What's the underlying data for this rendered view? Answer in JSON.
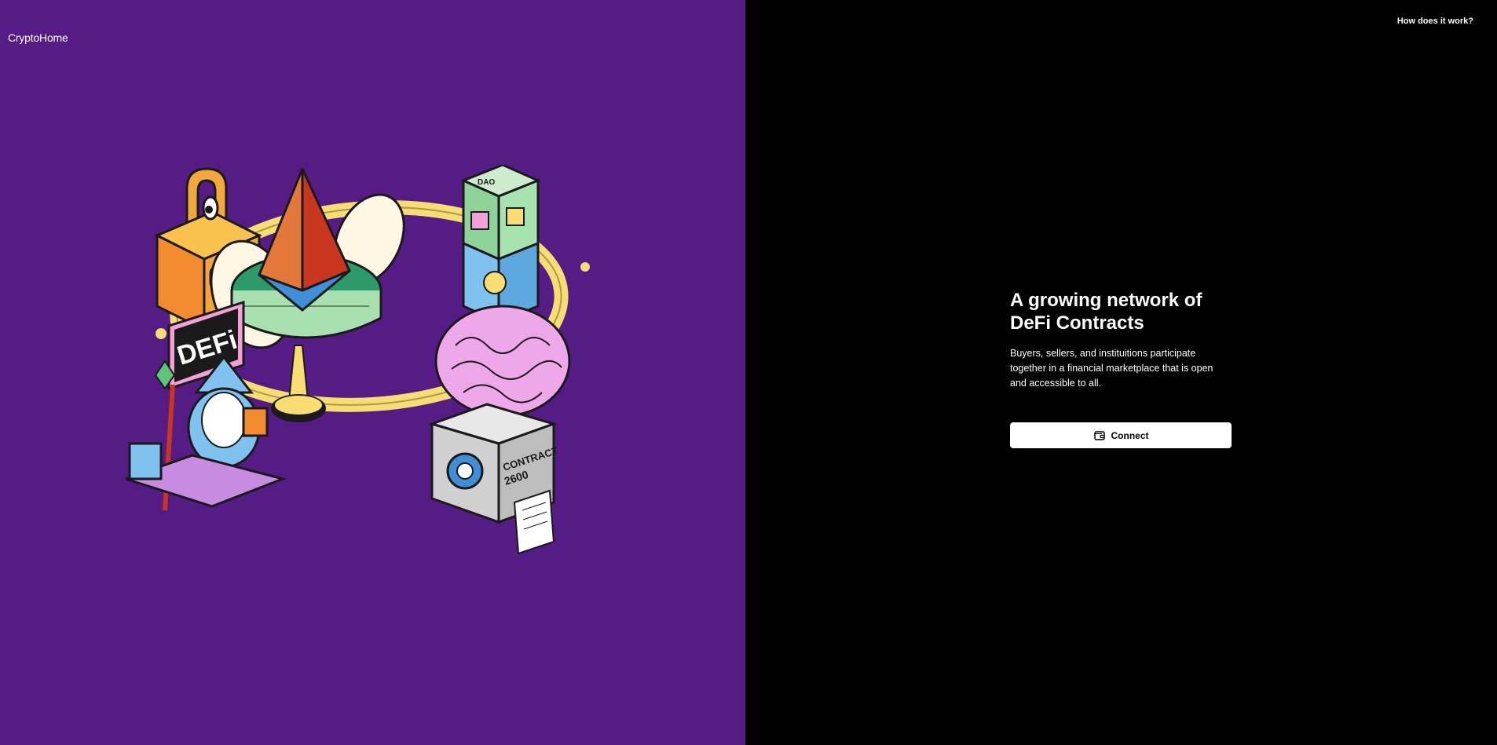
{
  "brand": {
    "name": "CryptoHome"
  },
  "header": {
    "help_link": "How does it work?"
  },
  "illustration": {
    "defi_sign": "DEFi",
    "dao_label": "DAO",
    "machine_label": "CONTRACT",
    "machine_number": "2600"
  },
  "hero": {
    "title_line1": "A growing network of",
    "title_line2": "DeFi Contracts",
    "description": "Buyers, sellers, and instituitions participate together in a financial marketplace that is open and accessible to all.",
    "connect_label": "Connect",
    "connect_icon": "wallet-icon"
  },
  "colors": {
    "left_background": "#561c86",
    "right_background": "#000000",
    "button_background": "#ffffff"
  }
}
